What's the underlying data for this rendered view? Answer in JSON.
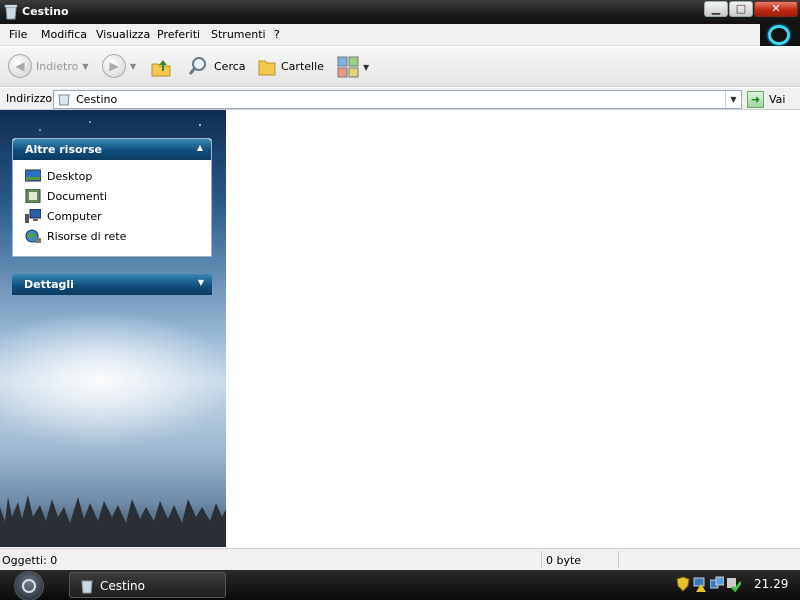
{
  "window": {
    "title": "Cestino",
    "controls": [
      "minimize",
      "maximize",
      "close"
    ]
  },
  "menu": [
    "File",
    "Modifica",
    "Visualizza",
    "Preferiti",
    "Strumenti",
    "?"
  ],
  "toolbar": {
    "back_label": "Indietro",
    "search_label": "Cerca",
    "folders_label": "Cartelle"
  },
  "address": {
    "label": "Indirizzo",
    "value": "Cestino",
    "go_label": "Vai"
  },
  "sidebar": {
    "panels": [
      {
        "title": "Altre risorse",
        "expanded": true,
        "links": [
          {
            "label": "Desktop",
            "icon": "desktop-icon"
          },
          {
            "label": "Documenti",
            "icon": "documents-icon"
          },
          {
            "label": "Computer",
            "icon": "computer-icon"
          },
          {
            "label": "Risorse di rete",
            "icon": "network-icon"
          }
        ]
      },
      {
        "title": "Dettagli",
        "expanded": false
      }
    ]
  },
  "status": {
    "objects": "Oggetti: 0",
    "size": "0 byte"
  },
  "taskbar": {
    "window_button": "Cestino",
    "clock": "21.29"
  },
  "colors": {
    "panel_header": "#0f4f7e",
    "title_bar": "#1c1c1c",
    "close_button": "#c02a12",
    "brand_ring": "#3fd6f0"
  }
}
